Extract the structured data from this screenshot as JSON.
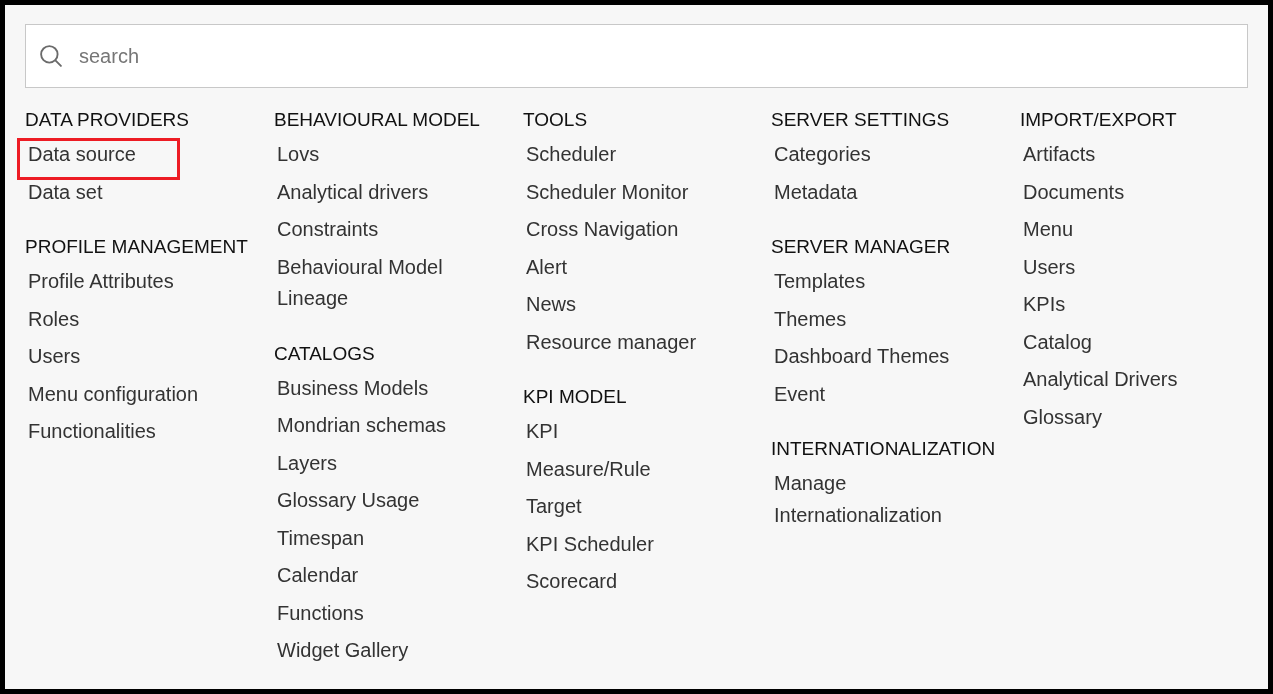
{
  "search": {
    "placeholder": "search"
  },
  "columns": [
    {
      "sections": [
        {
          "heading": "DATA PROVIDERS",
          "items": [
            {
              "label": "Data source",
              "highlighted": true
            },
            {
              "label": "Data set",
              "highlighted": false
            }
          ]
        },
        {
          "heading": "PROFILE MANAGEMENT",
          "items": [
            {
              "label": "Profile Attributes",
              "highlighted": false
            },
            {
              "label": "Roles",
              "highlighted": false
            },
            {
              "label": "Users",
              "highlighted": false
            },
            {
              "label": "Menu configuration",
              "highlighted": false
            },
            {
              "label": "Functionalities",
              "highlighted": false
            }
          ]
        }
      ]
    },
    {
      "sections": [
        {
          "heading": "BEHAVIOURAL MODEL",
          "items": [
            {
              "label": "Lovs",
              "highlighted": false
            },
            {
              "label": "Analytical drivers",
              "highlighted": false
            },
            {
              "label": "Constraints",
              "highlighted": false
            },
            {
              "label": "Behavioural Model Lineage",
              "highlighted": false
            }
          ]
        },
        {
          "heading": "CATALOGS",
          "items": [
            {
              "label": "Business Models",
              "highlighted": false
            },
            {
              "label": "Mondrian schemas",
              "highlighted": false
            },
            {
              "label": "Layers",
              "highlighted": false
            },
            {
              "label": "Glossary Usage",
              "highlighted": false
            },
            {
              "label": "Timespan",
              "highlighted": false
            },
            {
              "label": "Calendar",
              "highlighted": false
            },
            {
              "label": "Functions",
              "highlighted": false
            },
            {
              "label": "Widget Gallery",
              "highlighted": false
            }
          ]
        }
      ]
    },
    {
      "sections": [
        {
          "heading": "TOOLS",
          "items": [
            {
              "label": "Scheduler",
              "highlighted": false
            },
            {
              "label": "Scheduler Monitor",
              "highlighted": false
            },
            {
              "label": "Cross Navigation",
              "highlighted": false
            },
            {
              "label": "Alert",
              "highlighted": false
            },
            {
              "label": "News",
              "highlighted": false
            },
            {
              "label": "Resource manager",
              "highlighted": false
            }
          ]
        },
        {
          "heading": "KPI MODEL",
          "items": [
            {
              "label": "KPI",
              "highlighted": false
            },
            {
              "label": "Measure/Rule",
              "highlighted": false
            },
            {
              "label": "Target",
              "highlighted": false
            },
            {
              "label": "KPI Scheduler",
              "highlighted": false
            },
            {
              "label": "Scorecard",
              "highlighted": false
            }
          ]
        }
      ]
    },
    {
      "sections": [
        {
          "heading": "SERVER SETTINGS",
          "items": [
            {
              "label": "Categories",
              "highlighted": false
            },
            {
              "label": "Metadata",
              "highlighted": false
            }
          ]
        },
        {
          "heading": "SERVER MANAGER",
          "items": [
            {
              "label": "Templates",
              "highlighted": false
            },
            {
              "label": "Themes",
              "highlighted": false
            },
            {
              "label": "Dashboard Themes",
              "highlighted": false
            },
            {
              "label": "Event",
              "highlighted": false
            }
          ]
        },
        {
          "heading": "INTERNATIONALIZATION",
          "items": [
            {
              "label": "Manage Internationalization",
              "highlighted": false
            }
          ]
        }
      ]
    },
    {
      "sections": [
        {
          "heading": "IMPORT/EXPORT",
          "items": [
            {
              "label": "Artifacts",
              "highlighted": false
            },
            {
              "label": "Documents",
              "highlighted": false
            },
            {
              "label": "Menu",
              "highlighted": false
            },
            {
              "label": "Users",
              "highlighted": false
            },
            {
              "label": "KPIs",
              "highlighted": false
            },
            {
              "label": "Catalog",
              "highlighted": false
            },
            {
              "label": "Analytical Drivers",
              "highlighted": false
            },
            {
              "label": "Glossary",
              "highlighted": false
            }
          ]
        }
      ]
    }
  ]
}
